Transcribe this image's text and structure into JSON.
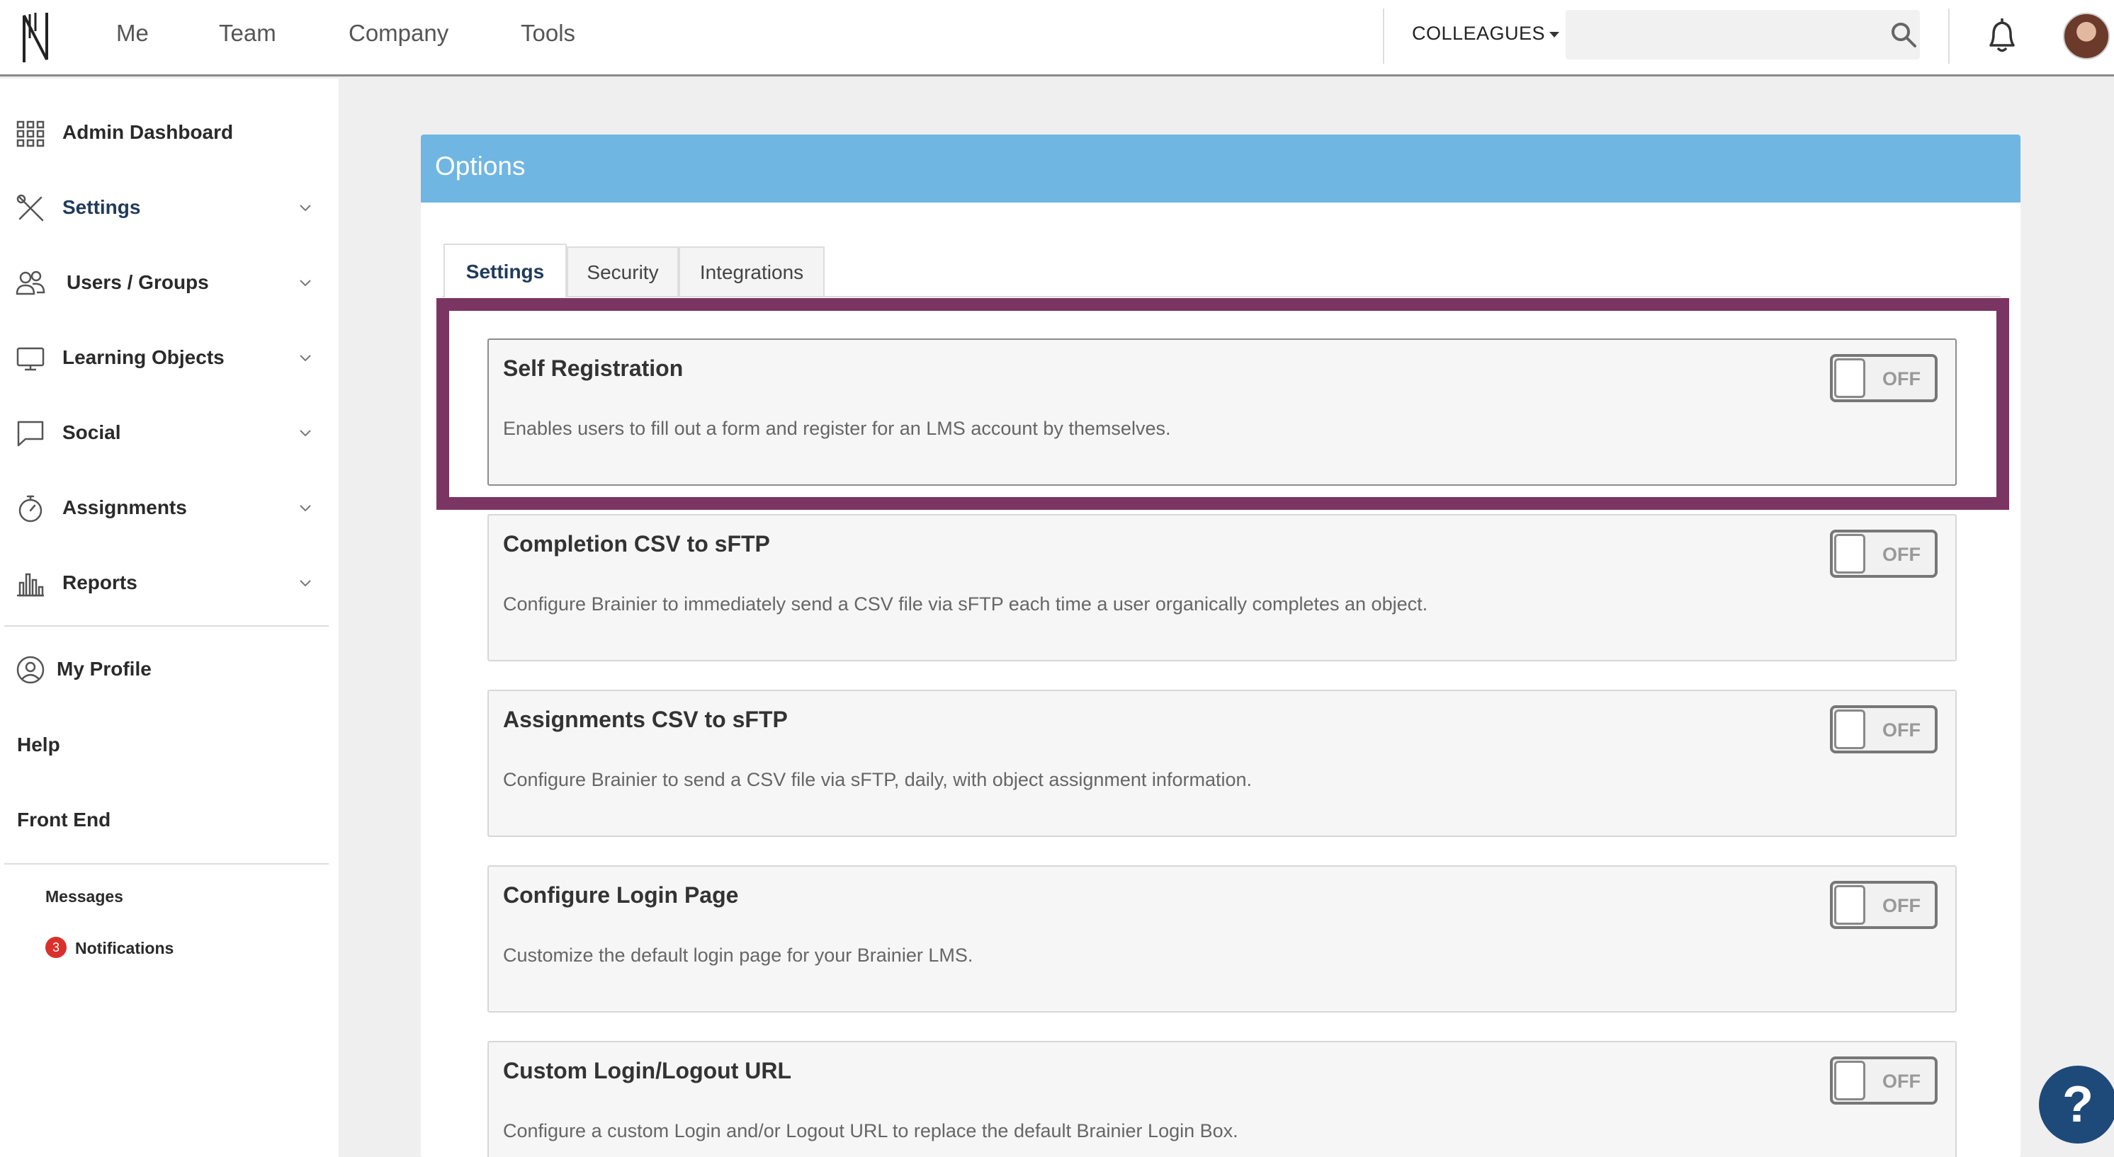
{
  "topbar": {
    "nav": [
      "Me",
      "Team",
      "Company",
      "Tools"
    ],
    "colleagues_label": "COLLEAGUES",
    "search_placeholder": "",
    "icons": {
      "logo": "brainier-logo",
      "search": "search-icon",
      "bell": "bell-icon",
      "avatar": "avatar"
    }
  },
  "sidebar": {
    "items": [
      {
        "label": "Admin Dashboard",
        "icon": "grid-icon",
        "expandable": false
      },
      {
        "label": "Settings",
        "icon": "tools-icon",
        "expandable": true
      },
      {
        "label": "Users / Groups",
        "icon": "users-icon",
        "expandable": true
      },
      {
        "label": "Learning Objects",
        "icon": "monitor-icon",
        "expandable": true
      },
      {
        "label": "Social",
        "icon": "chat-icon",
        "expandable": true
      },
      {
        "label": "Assignments",
        "icon": "stopwatch-icon",
        "expandable": true
      },
      {
        "label": "Reports",
        "icon": "bar-chart-icon",
        "expandable": true
      }
    ],
    "profile_label": "My Profile",
    "help_label": "Help",
    "front_end_label": "Front End",
    "messages_label": "Messages",
    "notifications_label": "Notifications",
    "notifications_count": "3"
  },
  "panel": {
    "title": "Options",
    "tabs": [
      "Settings",
      "Security",
      "Integrations"
    ],
    "active_tab": "Settings",
    "options": [
      {
        "title": "Self Registration",
        "description": "Enables users to fill out a form and register for an LMS account by themselves.",
        "state": "OFF"
      },
      {
        "title": "Completion CSV to sFTP",
        "description": "Configure Brainier to immediately send a CSV file via sFTP each time a user organically completes an object.",
        "state": "OFF"
      },
      {
        "title": "Assignments CSV to sFTP",
        "description": "Configure Brainier to send a CSV file via sFTP, daily, with object assignment information.",
        "state": "OFF"
      },
      {
        "title": "Configure Login Page",
        "description": "Customize the default login page for your Brainier LMS.",
        "state": "OFF"
      },
      {
        "title": "Custom Login/Logout URL",
        "description": "Configure a custom Login and/or Logout URL to replace the default Brainier Login Box.",
        "state": "OFF"
      }
    ]
  },
  "help_button": "?",
  "colors": {
    "header_blue": "#6fb6e2",
    "highlight": "#7b3563",
    "badge_red": "#d9302c",
    "help_navy": "#1e4a7a"
  }
}
